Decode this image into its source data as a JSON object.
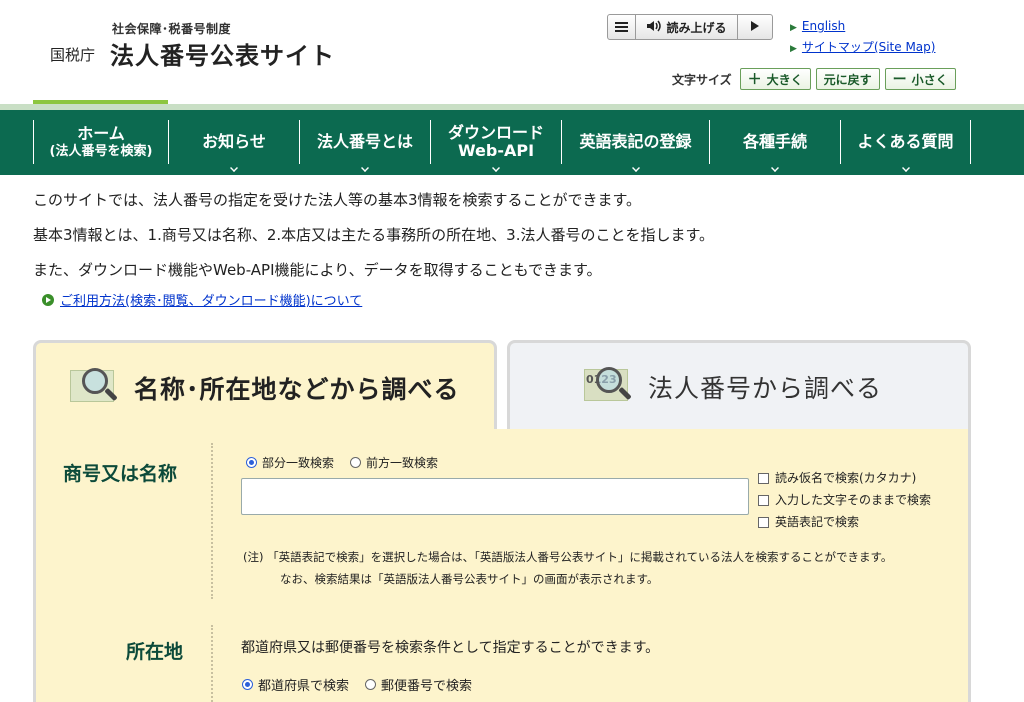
{
  "header": {
    "logo_sub": "社会保障･税番号制度",
    "logo_agency": "国税庁",
    "logo_main": "法人番号公表サイト",
    "tts_read_label": "読み上げる",
    "links": [
      {
        "label": "English"
      },
      {
        "label": "サイトマップ(Site Map)"
      }
    ],
    "font_size_label": "文字サイズ",
    "font_buttons": [
      {
        "symbol": "＋",
        "label": "大きく"
      },
      {
        "symbol": "",
        "label": "元に戻す"
      },
      {
        "symbol": "ー",
        "label": "小さく"
      }
    ]
  },
  "nav": {
    "items": [
      {
        "line1": "ホーム",
        "line2": "(法人番号を検索)"
      },
      {
        "line1": "お知らせ",
        "line2": ""
      },
      {
        "line1": "法人番号とは",
        "line2": ""
      },
      {
        "line1": "ダウンロード",
        "line2": "Web-API"
      },
      {
        "line1": "英語表記の登録",
        "line2": ""
      },
      {
        "line1": "各種手続",
        "line2": ""
      },
      {
        "line1": "よくある質問",
        "line2": ""
      }
    ]
  },
  "intro": {
    "lines": [
      "このサイトでは、法人番号の指定を受けた法人等の基本3情報を検索することができます。",
      "基本3情報とは、1.商号又は名称、2.本店又は主たる事務所の所在地、3.法人番号のことを指します。",
      "また、ダウンロード機能やWeb-API機能により、データを取得することもできます。"
    ],
    "usage_link": "ご利用方法(検索･閲覧、ダウンロード機能)について"
  },
  "tabs": [
    {
      "label": "名称･所在地などから調べる",
      "active": true
    },
    {
      "label": "法人番号から調べる",
      "active": false,
      "icon_text": "0123"
    }
  ],
  "name_section": {
    "title": "商号又は名称",
    "radios": [
      {
        "label": "部分一致検索",
        "checked": true
      },
      {
        "label": "前方一致検索",
        "checked": false
      }
    ],
    "input_value": "",
    "checkboxes": [
      {
        "label": "読み仮名で検索(カタカナ)",
        "checked": false
      },
      {
        "label": "入力した文字そのままで検索",
        "checked": false
      },
      {
        "label": "英語表記で検索",
        "checked": false
      }
    ],
    "note_line1": "(注) 「英語表記で検索」を選択した場合は、「英語版法人番号公表サイト」に掲載されている法人を検索することができます。",
    "note_line2": "なお、検索結果は「英語版法人番号公表サイト」の画面が表示されます。"
  },
  "address_section": {
    "title": "所在地",
    "description": "都道府県又は郵便番号を検索条件として指定することができます。",
    "radios": [
      {
        "label": "都道府県で検索",
        "checked": true
      },
      {
        "label": "郵便番号で検索",
        "checked": false
      }
    ]
  }
}
